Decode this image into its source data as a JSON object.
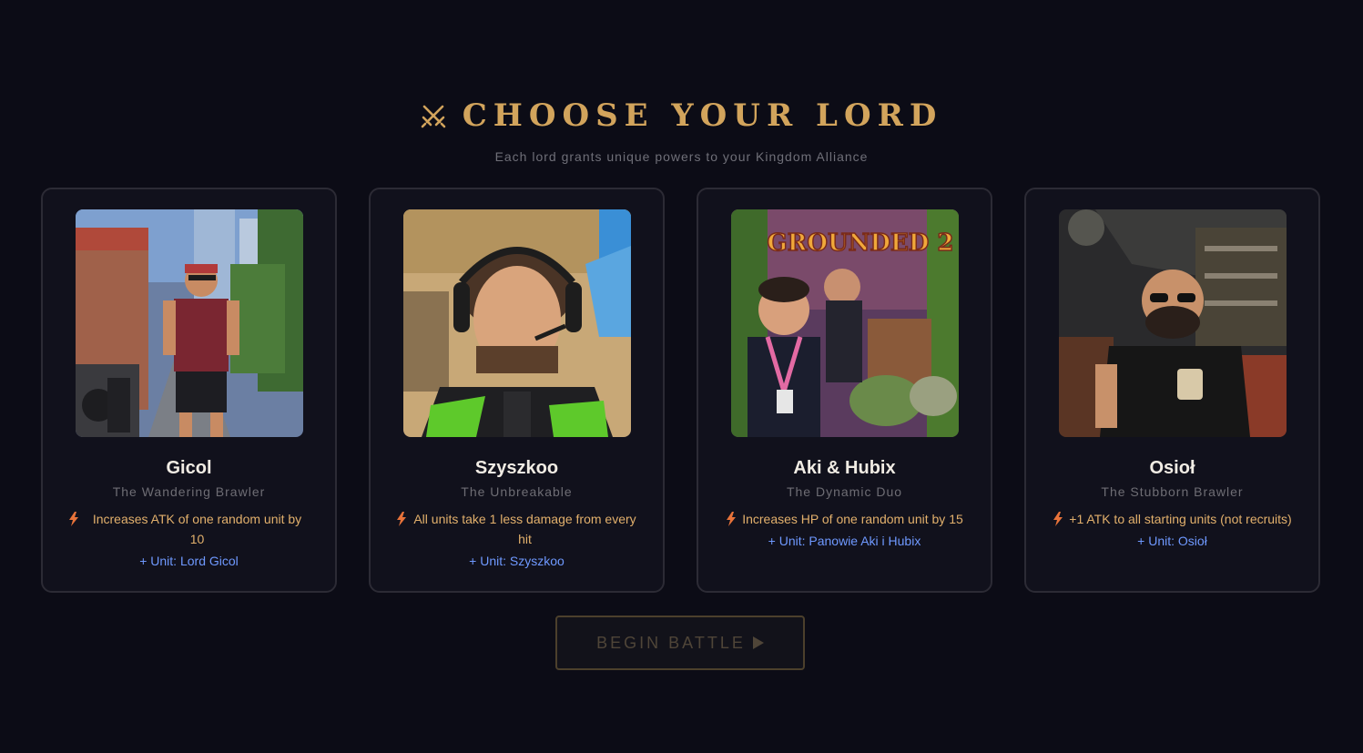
{
  "header": {
    "title": "CHOOSE YOUR LORD",
    "subtitle": "Each lord grants unique powers to your Kingdom Alliance",
    "icon": "crossed-swords-icon"
  },
  "colors": {
    "background": "#0c0c16",
    "title": "#d2a45c",
    "ability": "#e2b06c",
    "unit": "#6f99ff"
  },
  "lords": [
    {
      "name": "Gicol",
      "epithet": "The Wandering Brawler",
      "ability": "Increases ATK of one random unit by 10",
      "unit": "+ Unit: Lord Gicol"
    },
    {
      "name": "Szyszkoo",
      "epithet": "The Unbreakable",
      "ability": "All units take 1 less damage from every hit",
      "unit": "+ Unit: Szyszkoo"
    },
    {
      "name": "Aki & Hubix",
      "epithet": "The Dynamic Duo",
      "ability": "Increases HP of one random unit by 15",
      "unit": "+ Unit: Panowie Aki i Hubix",
      "portrait_text": "GROUNDED 2"
    },
    {
      "name": "Osioł",
      "epithet": "The Stubborn Brawler",
      "ability": "+1 ATK to all starting units (not recruits)",
      "unit": "+ Unit: Osioł"
    }
  ],
  "begin_button": {
    "label": "BEGIN BATTLE",
    "state": "disabled"
  }
}
